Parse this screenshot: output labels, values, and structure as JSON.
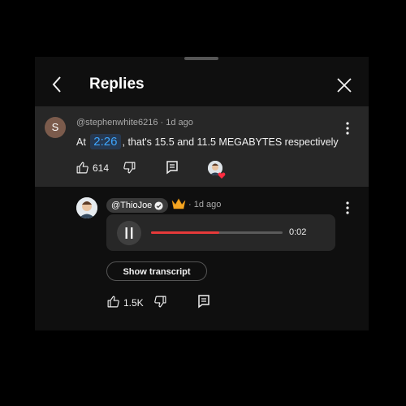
{
  "header": {
    "title": "Replies"
  },
  "parent_comment": {
    "avatar_letter": "S",
    "author": "@stephenwhite6216",
    "age": "1d ago",
    "text_before": "At",
    "timestamp": "2:26",
    "text_after": ", that's 15.5 and 11.5 MEGABYTES respectively",
    "likes": "614"
  },
  "reply": {
    "author": "@ThioJoe",
    "age": "1d ago",
    "audio_time": "0:02",
    "audio_progress": 0.52,
    "transcript_label": "Show transcript",
    "likes": "1.5K"
  },
  "colors": {
    "accent_link": "#3ea6ff",
    "progress": "#e63a3a",
    "crown": "#f5a623"
  },
  "icons": [
    "back-arrow-icon",
    "close-icon",
    "like-icon",
    "dislike-icon",
    "reply-icon",
    "more-vert-icon",
    "verified-icon",
    "crown-icon",
    "pause-icon",
    "heart-icon"
  ]
}
